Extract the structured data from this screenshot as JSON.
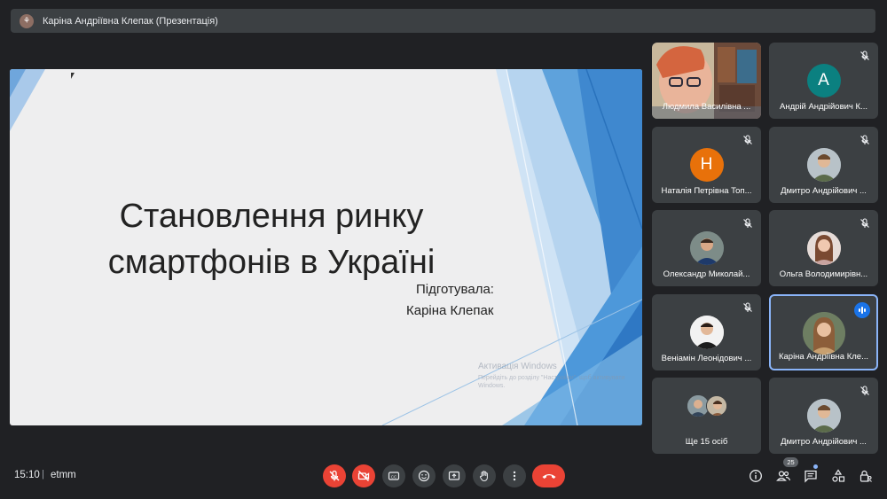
{
  "header": {
    "title": "Каріна Андріївна Клепак (Презентація)",
    "icon": "presenter-avatar-icon"
  },
  "slide": {
    "title_line1": "Становлення ринку",
    "title_line2": "смартфонів в Україні",
    "prepared_label": "Підготувала:",
    "author": "Каріна Клепак",
    "watermark_line1": "Активація Windows",
    "watermark_line2": "Перейдіть до розділу \"Настройки\", щоб активувати Windows."
  },
  "participants": [
    {
      "name": "Людмила Василівна ...",
      "type": "video",
      "muted": false
    },
    {
      "name": "Андрій Андрійович К...",
      "initial": "A",
      "avatar_color": "#0b8080",
      "muted": true
    },
    {
      "name": "Наталія Петрівна Топ...",
      "initial": "Н",
      "avatar_color": "#e8710a",
      "muted": true
    },
    {
      "name": "Дмитро Андрійович ...",
      "type": "photo",
      "muted": true
    },
    {
      "name": "Олександр Миколай...",
      "type": "photo",
      "muted": true
    },
    {
      "name": "Ольга Володимирівн...",
      "type": "photo",
      "muted": true
    },
    {
      "name": "Веніамін Леонідович ...",
      "type": "photo",
      "muted": true
    },
    {
      "name": "Каріна Андріївна Кле...",
      "type": "photo",
      "speaking": true
    },
    {
      "name": "Ще 15 осіб",
      "type": "more"
    },
    {
      "name": "Дмитро Андрійович ...",
      "type": "photo",
      "muted": true
    }
  ],
  "footer": {
    "time": "15:10",
    "separator": "|",
    "meeting_code": "etmm",
    "participant_count": "25"
  },
  "colors": {
    "background": "#202124",
    "tile": "#3c4043",
    "danger": "#ea4335",
    "accent": "#8ab4f8"
  }
}
